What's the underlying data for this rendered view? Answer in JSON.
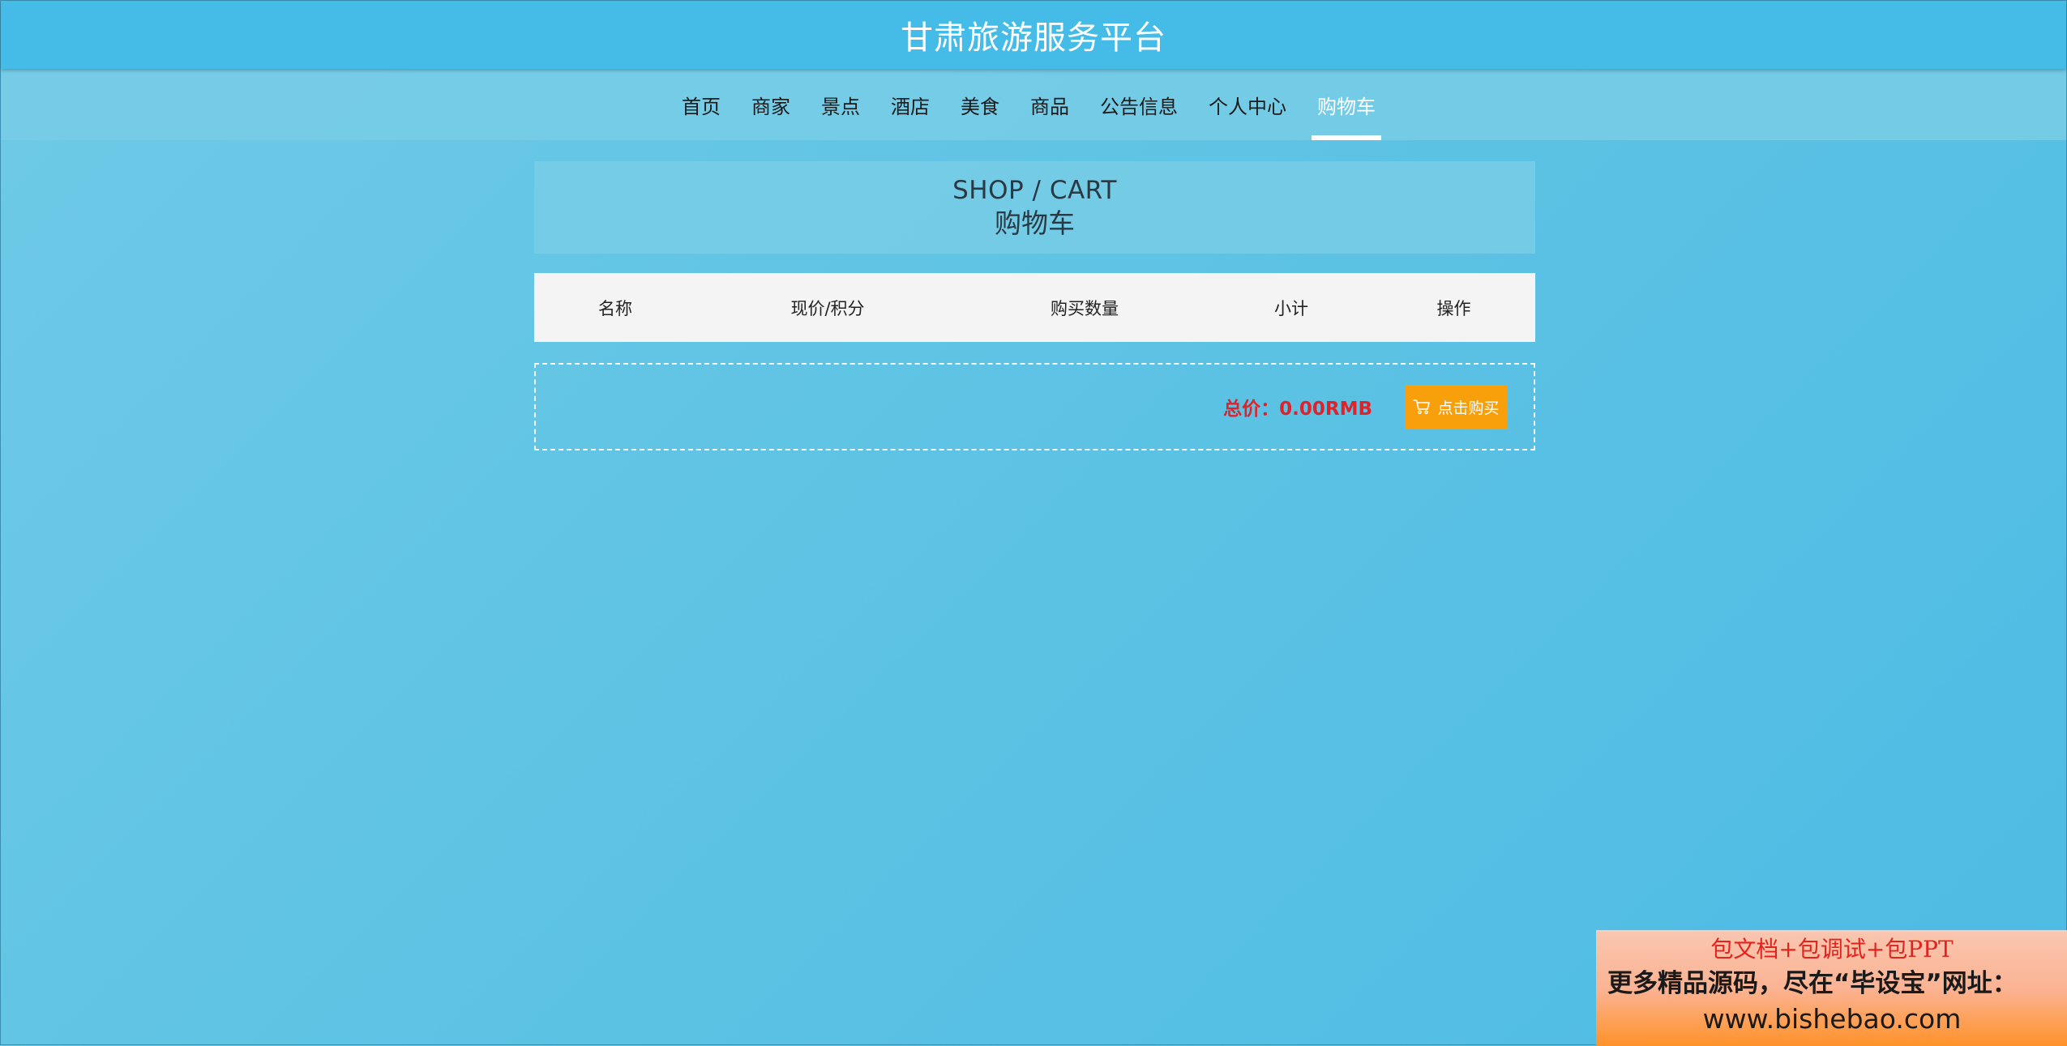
{
  "header": {
    "title": "甘肃旅游服务平台"
  },
  "nav": {
    "items": [
      {
        "label": "首页"
      },
      {
        "label": "商家"
      },
      {
        "label": "景点"
      },
      {
        "label": "酒店"
      },
      {
        "label": "美食"
      },
      {
        "label": "商品"
      },
      {
        "label": "公告信息"
      },
      {
        "label": "个人中心"
      },
      {
        "label": "购物车"
      }
    ],
    "active": "购物车"
  },
  "section": {
    "title_en": "SHOP / CART",
    "title_cn": "购物车"
  },
  "cart": {
    "columns": [
      "名称",
      "现价/积分",
      "购买数量",
      "小计",
      "操作"
    ],
    "rows": [],
    "total_label": "总价：0.00RMB",
    "buy_label": "点击购买"
  },
  "promo": {
    "line1": "包文档+包调试+包PPT",
    "line2": "更多精品源码，尽在“毕设宝”网址：",
    "line3": "www.bishebao.com"
  },
  "colors": {
    "header_bg": "#45bce8",
    "nav_bg": "#78cde6",
    "page_bg": "#5ec3e4",
    "total_text": "#e0222a",
    "buy_button": "#f89f0c"
  },
  "icons": {
    "buy_button_icon": "cart-icon"
  }
}
